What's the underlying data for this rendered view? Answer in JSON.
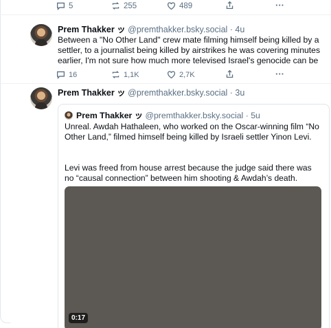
{
  "top_actions": {
    "replies": "5",
    "reposts": "255",
    "likes": "489",
    "more": "···"
  },
  "post1": {
    "author": "Prem Thakker ッ",
    "handle": "@premthakker.bsky.social",
    "time": "· 4u",
    "text": "Between a \"No Other Land\" crew mate filming himself being killed by a settler, to a journalist being killed by airstrikes he was covering minutes earlier, I'm not sure how much more televised Israel's genocide can be",
    "replies": "16",
    "reposts": "1,1K",
    "likes": "2,7K",
    "more": "···"
  },
  "post2": {
    "author": "Prem Thakker ッ",
    "handle": "@premthakker.bsky.social",
    "time": "· 3u",
    "quote": {
      "author": "Prem Thakker ッ",
      "handle": "@premthakker.bsky.social",
      "time": "· 5u",
      "paragraph1": "Unreal. Awdah Hathaleen, who worked on the Oscar-winning film “No Other Land,” filmed himself being killed by Israeli settler Yinon Levi.",
      "paragraph2": "Levi was freed from house arrest because the judge said there was no “causal connection” between him shooting & Awdah’s death.",
      "video_duration": "0:17"
    }
  },
  "icons": [
    "reply-icon",
    "repost-icon",
    "like-icon",
    "share-icon",
    "more-icon"
  ],
  "colors": {
    "muted": "#5b7083",
    "text": "#0b0f14",
    "border": "#dfe4ea",
    "video": "#5c5854"
  }
}
